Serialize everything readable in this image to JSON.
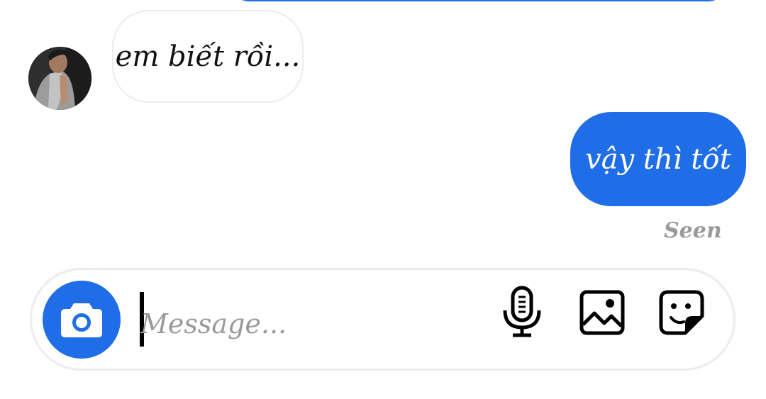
{
  "conversation": {
    "incoming_message": "em biết rồi...",
    "outgoing_message": "vậy thì tốt",
    "seen_label": "Seen"
  },
  "composer": {
    "placeholder": "Message...",
    "camera_icon": "camera-icon",
    "mic_icon": "microphone-icon",
    "image_icon": "image-icon",
    "sticker_icon": "sticker-icon"
  },
  "colors": {
    "accent": "#1f6ee8",
    "background": "#ffffff",
    "bubble_border": "#ececec",
    "muted_text": "#9a9a9a",
    "text": "#111111"
  }
}
